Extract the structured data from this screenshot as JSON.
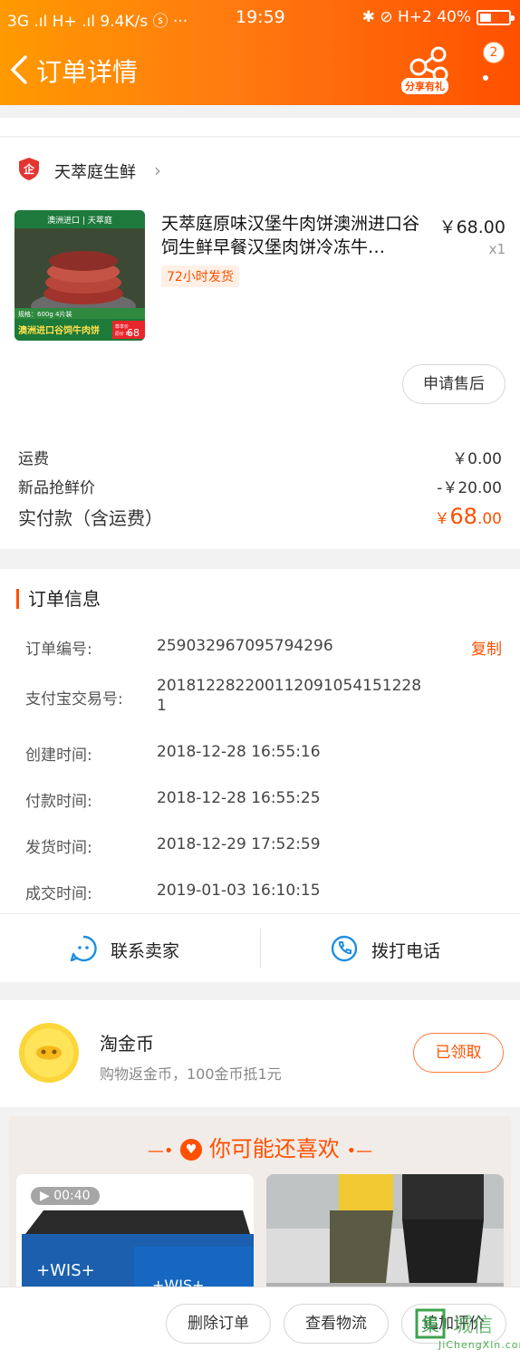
{
  "status_bar": {
    "left": "3G .ıl H+ .ıl 9.4K/s ⓢ ···",
    "time": "19:59",
    "right": "✱ ⊘ H+2 40%"
  },
  "header": {
    "title": "订单详情",
    "share_label": "分享有礼",
    "badge_count": "2"
  },
  "shop": {
    "name": "天萃庭生鲜"
  },
  "product": {
    "title": "天萃庭原味汉堡牛肉饼澳洲进口谷饲生鲜早餐汉堡肉饼冷冻牛…",
    "price": "￥68.00",
    "qty": "x1",
    "tag": "72小时发货",
    "image_banner_top": "澳洲进口 | 天萃庭",
    "image_spec": "规格：600g 4片装",
    "image_caption": "澳洲进口谷饲牛肉饼",
    "image_price_tag": "68",
    "image_price_small": "尊享价",
    "image_orig_small": "原价 88"
  },
  "after_sale_label": "申请售后",
  "fees": {
    "shipping_label": "运费",
    "shipping_value": "￥0.00",
    "discount_label": "新品抢鲜价",
    "discount_value": "-￥20.00",
    "paid_label": "实付款（含运费）",
    "paid_currency": "￥",
    "paid_int": "68",
    "paid_dec": ".00"
  },
  "order_info": {
    "heading": "订单信息",
    "copy_label": "复制",
    "rows": [
      {
        "label": "订单编号:",
        "value": "259032967095794296"
      },
      {
        "label": "支付宝交易号:",
        "value": "2018122822001120910541512281"
      },
      {
        "label": "创建时间:",
        "value": "2018-12-28 16:55:16"
      },
      {
        "label": "付款时间:",
        "value": "2018-12-28 16:55:25"
      },
      {
        "label": "发货时间:",
        "value": "2018-12-29 17:52:59"
      },
      {
        "label": "成交时间:",
        "value": "2019-01-03 16:10:15"
      }
    ]
  },
  "contact": {
    "seller_label": "联系卖家",
    "phone_label": "拨打电话"
  },
  "coins": {
    "title": "淘金币",
    "subtitle": "购物返金币，100金币抵1元",
    "button": "已领取"
  },
  "recommend": {
    "title": "你可能还喜欢",
    "video_time": "00:40",
    "brand_text": "+WIS+"
  },
  "bottom_bar": {
    "delete_label": "删除订单",
    "logistics_label": "查看物流",
    "review_label": "追加评价"
  },
  "watermark": {
    "text": "JiChengXin.com",
    "chars": "集城信"
  },
  "colors": {
    "accent": "#ff5000",
    "header_start": "#ff9a00",
    "header_end": "#ff5000",
    "link_blue": "#1e8fe0"
  }
}
